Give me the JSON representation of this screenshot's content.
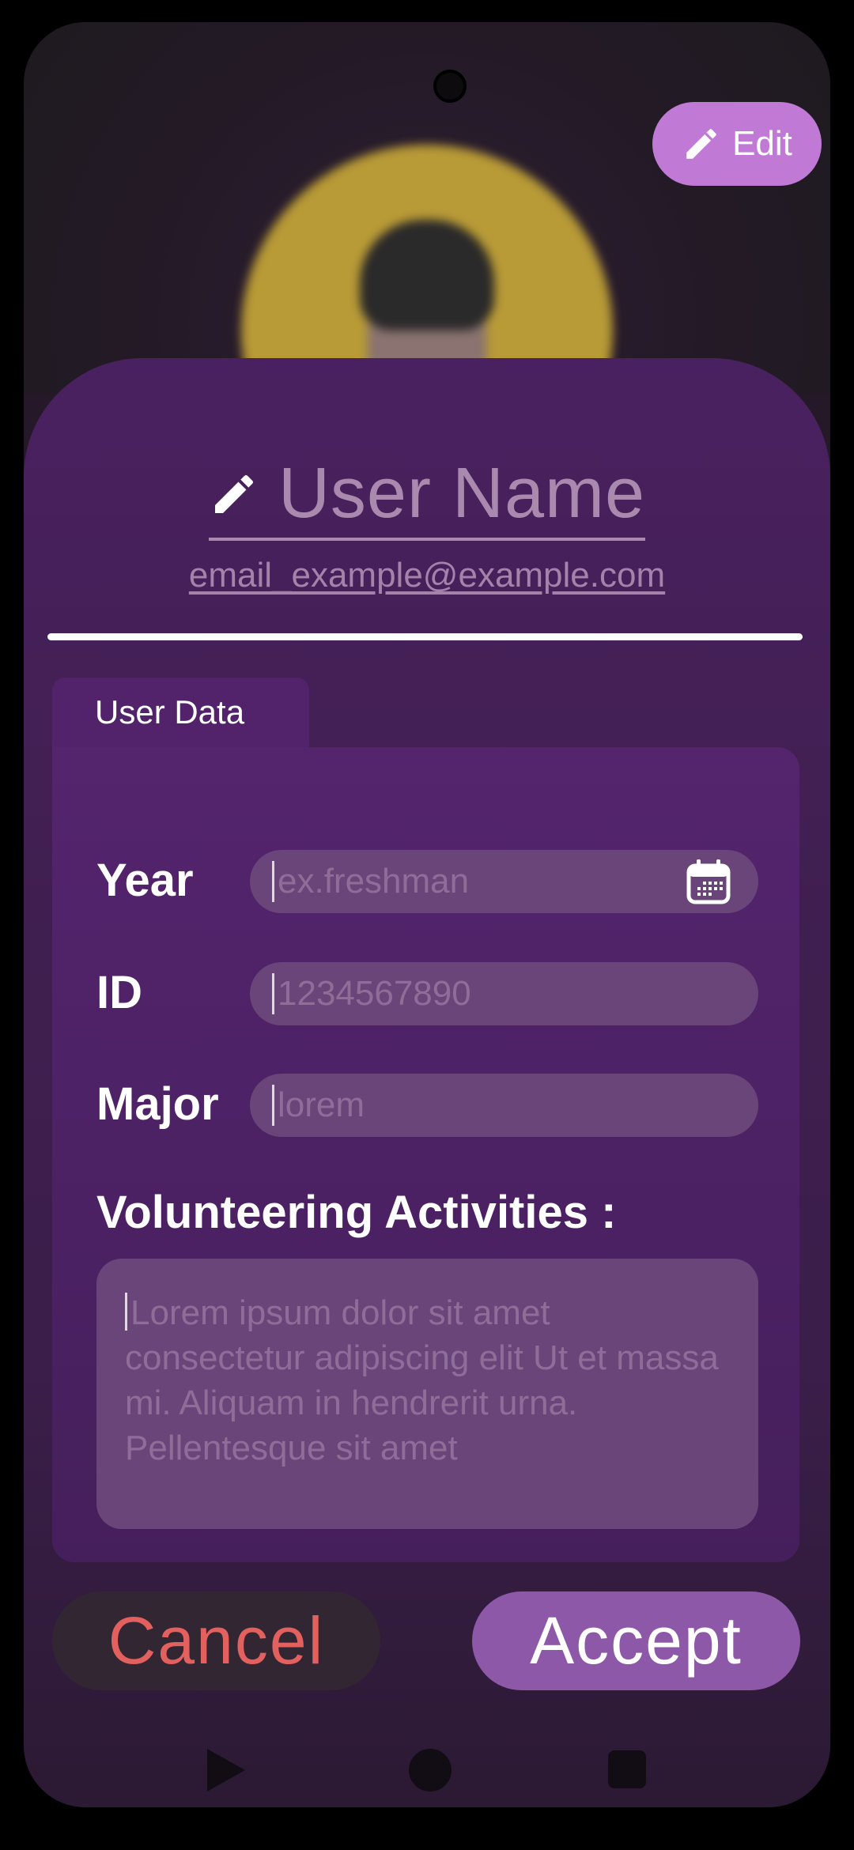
{
  "header": {
    "edit_label": "Edit",
    "edit_icon": "pencil-icon"
  },
  "profile": {
    "user_name": "User Name",
    "email": "email_example@example.com",
    "name_icon": "pencil-icon"
  },
  "tab": {
    "label": "User Data"
  },
  "form": {
    "year": {
      "label": "Year",
      "placeholder": "ex.freshman",
      "icon": "calendar-icon"
    },
    "id": {
      "label": "ID",
      "placeholder": "1234567890"
    },
    "major": {
      "label": "Major",
      "placeholder": "lorem"
    },
    "activities": {
      "label": "Volunteering Activities :",
      "placeholder": "Lorem ipsum dolor sit amet consectetur adipiscing elit Ut et massa mi. Aliquam in hendrerit urna. Pellentesque sit amet"
    }
  },
  "actions": {
    "cancel_label": "Cancel",
    "accept_label": "Accept"
  },
  "colors": {
    "accent": "#c07ad6",
    "accept": "#8e58a9",
    "cancel_text": "#e2605d",
    "sheet": "#4a2160"
  },
  "navbar": {
    "icons": [
      "back-icon",
      "home-icon",
      "recents-icon"
    ]
  }
}
